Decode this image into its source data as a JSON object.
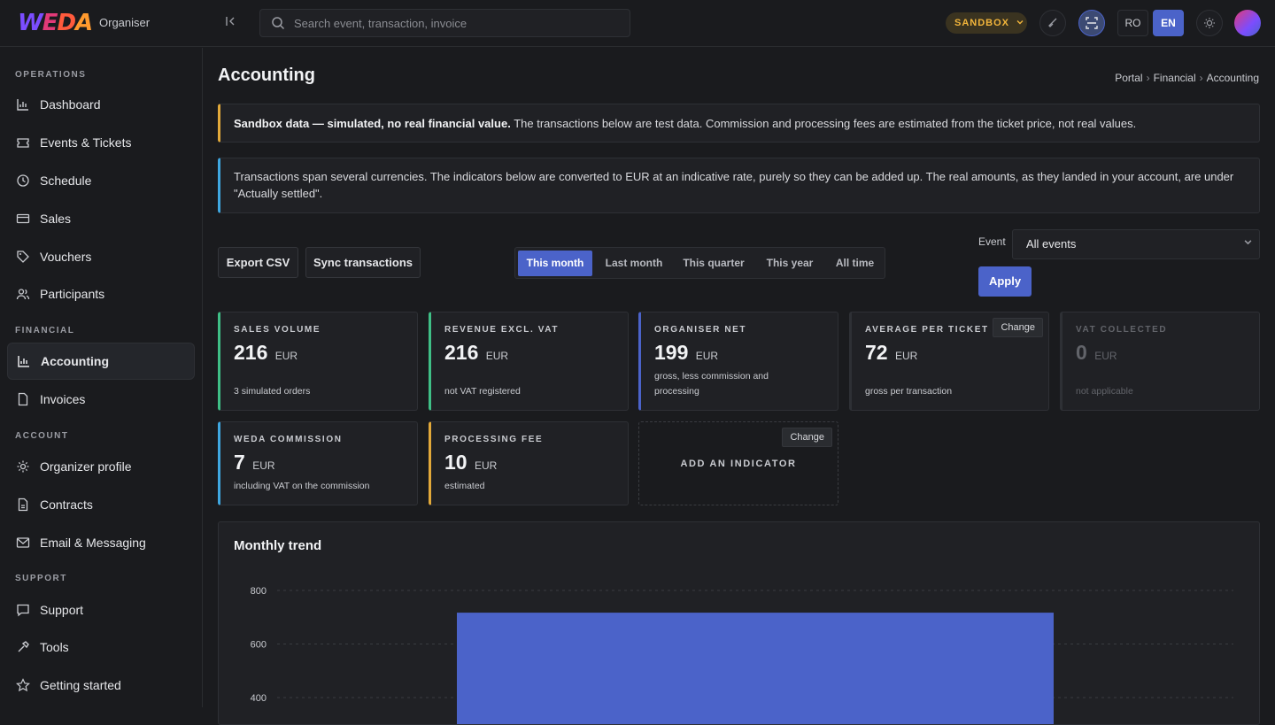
{
  "brand": {
    "logo": [
      "W",
      "E",
      "D",
      "A"
    ],
    "section": "Organiser"
  },
  "search": {
    "placeholder": "Search event, transaction, invoice"
  },
  "top": {
    "sandbox_label": "SANDBOX",
    "lang_ro": "RO",
    "lang_en": "EN",
    "active_lang": "EN"
  },
  "sidebar": {
    "operations_title": "OPERATIONS",
    "financial_title": "FINANCIAL",
    "account_title": "ACCOUNT",
    "support_title": "SUPPORT",
    "items": {
      "dashboard": "Dashboard",
      "events": "Events & Tickets",
      "schedule": "Schedule",
      "sales": "Sales",
      "vouchers": "Vouchers",
      "participants": "Participants",
      "accounting": "Accounting",
      "invoices": "Invoices",
      "organizer_profile": "Organizer profile",
      "contracts": "Contracts",
      "email": "Email & Messaging",
      "support": "Support",
      "tools": "Tools",
      "getting_started": "Getting started"
    },
    "active": "accounting"
  },
  "page": {
    "title": "Accounting",
    "breadcrumb": [
      "Portal",
      "Financial",
      "Accounting"
    ]
  },
  "alerts": {
    "sandbox_bold": "Sandbox data — simulated, no real financial value.",
    "sandbox_text": " The transactions below are test data. Commission and processing fees are estimated from the ticket price, not real values.",
    "currency_text": "Transactions span several currencies. The indicators below are converted to EUR at an indicative rate, purely so they can be added up. The real amounts, as they landed in your account, are under \"Actually settled\"."
  },
  "toolbar": {
    "export_label": "Export CSV",
    "sync_label": "Sync transactions",
    "periods": [
      "This month",
      "Last month",
      "This quarter",
      "This year",
      "All time"
    ],
    "active_period": "This month",
    "event_label": "Event",
    "event_value": "All events",
    "apply_label": "Apply"
  },
  "cards": [
    {
      "title": "SALES VOLUME",
      "value": "216",
      "unit": "EUR",
      "sub": "3 simulated orders",
      "accent": "#3fbf86"
    },
    {
      "title": "REVENUE EXCL. VAT",
      "value": "216",
      "unit": "EUR",
      "sub": "not VAT registered",
      "accent": "#3fbf86"
    },
    {
      "title": "ORGANISER NET",
      "value": "199",
      "unit": "EUR",
      "sub": "gross, less commission and processing",
      "accent": "#4b63c9"
    },
    {
      "title": "AVERAGE PER TICKET",
      "value": "72",
      "unit": "EUR",
      "sub": "gross per transaction",
      "accent": "#2e3035",
      "change": "Change"
    },
    {
      "title": "VAT COLLECTED",
      "value": "0",
      "unit": "EUR",
      "sub": "not applicable",
      "accent": "#2e3035"
    },
    {
      "title": "WEDA COMMISSION",
      "value": "7",
      "unit": "EUR",
      "sub": "including VAT on the commission",
      "accent": "#3fa7e0"
    },
    {
      "title": "PROCESSING FEE",
      "value": "10",
      "unit": "EUR",
      "sub": "estimated",
      "accent": "#e2a93a"
    }
  ],
  "add_indicator": {
    "label": "ADD AN INDICATOR",
    "change": "Change"
  },
  "chart_data": {
    "type": "bar",
    "title": "Monthly trend",
    "yticks": [
      "800",
      "600",
      "400"
    ],
    "ylim": [
      0,
      800
    ],
    "categories": [
      ""
    ],
    "values": [
      717
    ],
    "bar_color": "#4b63c9",
    "grid": true
  }
}
